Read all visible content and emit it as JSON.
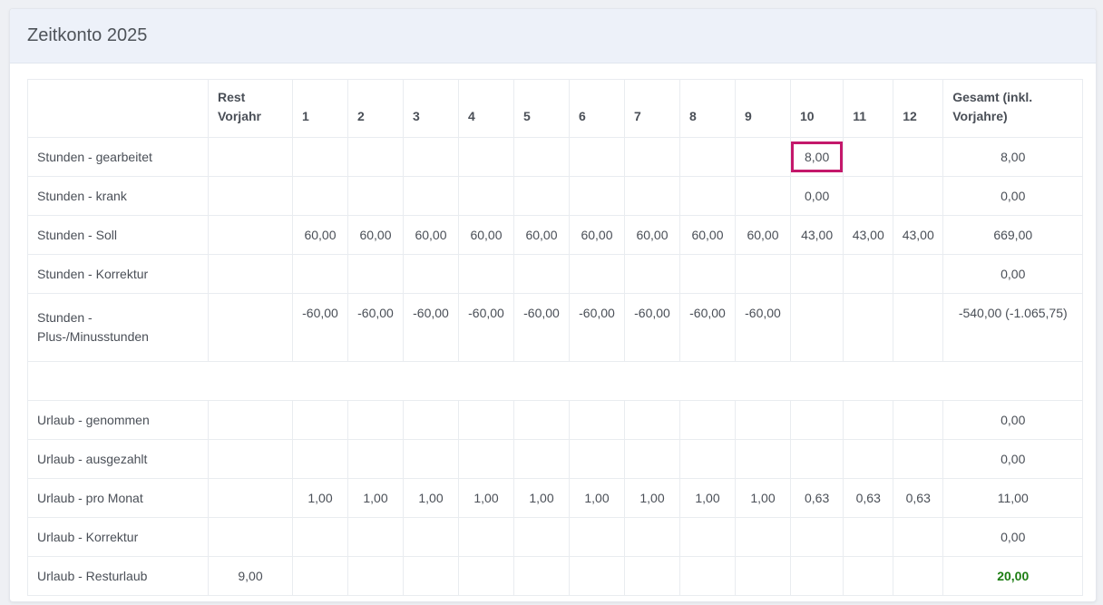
{
  "title": "Zeitkonto 2025",
  "columns": [
    "Rest Vorjahr",
    "1",
    "2",
    "3",
    "4",
    "5",
    "6",
    "7",
    "8",
    "9",
    "10",
    "11",
    "12",
    "Gesamt (inkl. Vorjahre)"
  ],
  "rows": [
    {
      "label": "Stunden - gearbeitet",
      "cells": [
        "",
        "",
        "",
        "",
        "",
        "",
        "",
        "",
        "",
        "",
        "8,00",
        "",
        "",
        "8,00"
      ]
    },
    {
      "label": "Stunden - krank",
      "cells": [
        "",
        "",
        "",
        "",
        "",
        "",
        "",
        "",
        "",
        "",
        "0,00",
        "",
        "",
        "0,00"
      ]
    },
    {
      "label": "Stunden - Soll",
      "cells": [
        "",
        "60,00",
        "60,00",
        "60,00",
        "60,00",
        "60,00",
        "60,00",
        "60,00",
        "60,00",
        "60,00",
        "43,00",
        "43,00",
        "43,00",
        "669,00"
      ]
    },
    {
      "label": "Stunden - Korrektur",
      "cells": [
        "",
        "",
        "",
        "",
        "",
        "",
        "",
        "",
        "",
        "",
        "",
        "",
        "",
        "0,00"
      ]
    },
    {
      "label": "Stunden - Plus-/Minusstunden",
      "cells": [
        "",
        "-60,00",
        "-60,00",
        "-60,00",
        "-60,00",
        "-60,00",
        "-60,00",
        "-60,00",
        "-60,00",
        "-60,00",
        "",
        "",
        "",
        "-540,00 (-1.065,75)"
      ]
    },
    {
      "label": "Urlaub - genommen",
      "cells": [
        "",
        "",
        "",
        "",
        "",
        "",
        "",
        "",
        "",
        "",
        "",
        "",
        "",
        "0,00"
      ]
    },
    {
      "label": "Urlaub - ausgezahlt",
      "cells": [
        "",
        "",
        "",
        "",
        "",
        "",
        "",
        "",
        "",
        "",
        "",
        "",
        "",
        "0,00"
      ]
    },
    {
      "label": "Urlaub - pro Monat",
      "cells": [
        "",
        "1,00",
        "1,00",
        "1,00",
        "1,00",
        "1,00",
        "1,00",
        "1,00",
        "1,00",
        "1,00",
        "0,63",
        "0,63",
        "0,63",
        "11,00"
      ]
    },
    {
      "label": "Urlaub - Korrektur",
      "cells": [
        "",
        "",
        "",
        "",
        "",
        "",
        "",
        "",
        "",
        "",
        "",
        "",
        "",
        "0,00"
      ]
    },
    {
      "label": "Urlaub - Resturlaub",
      "cells": [
        "9,00",
        "",
        "",
        "",
        "",
        "",
        "",
        "",
        "",
        "",
        "",
        "",
        "",
        "20,00"
      ]
    }
  ],
  "colors": {
    "highlight_border": "#c4186b",
    "positive_total": "#1c7d12",
    "header_bg": "#edf1f9"
  }
}
